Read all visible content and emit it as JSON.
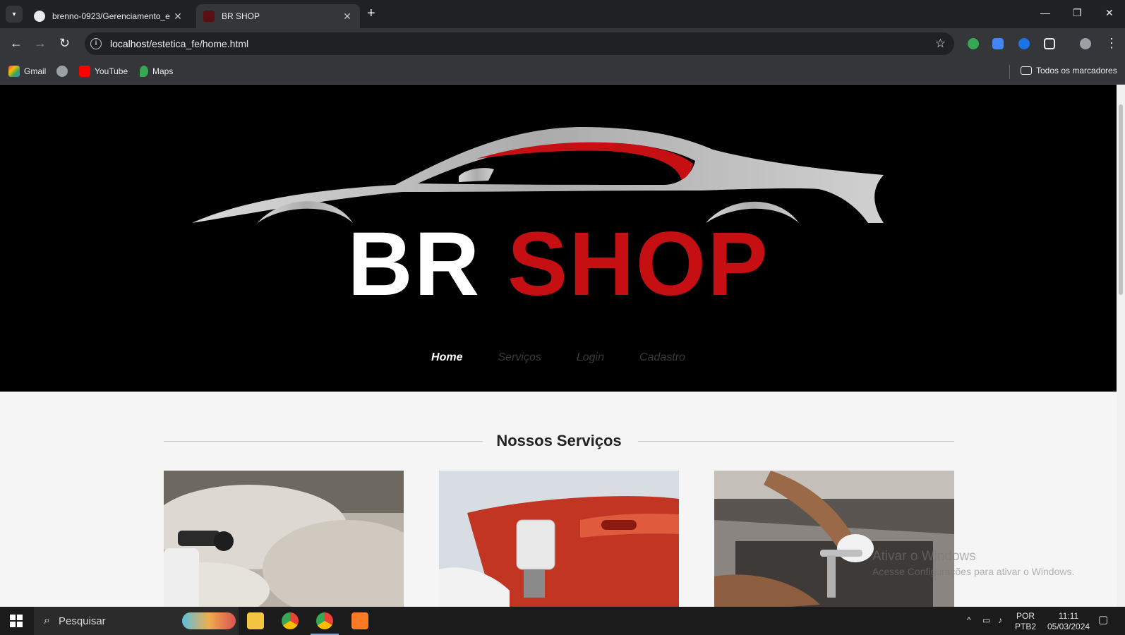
{
  "browser": {
    "tabs": [
      {
        "title": "brenno-0923/Gerenciamento_e",
        "active": false
      },
      {
        "title": "BR SHOP",
        "active": true
      }
    ],
    "url_host": "localhost",
    "url_path": "/estetica_fe/home.html",
    "bookmarks": [
      "Gmail",
      "YouTube",
      "Maps"
    ],
    "all_bookmarks": "Todos os marcadores"
  },
  "page": {
    "brand_white": "BR",
    "brand_red": "SHOP",
    "nav": [
      "Home",
      "Serviços",
      "Login",
      "Cadastro"
    ],
    "services_heading": "Nossos Serviços",
    "cards": [
      "car-foam-wash-photo",
      "car-paint-spray-photo",
      "engine-repair-photo"
    ]
  },
  "watermark": {
    "line1": "Ativar o Windows",
    "line2": "Acesse Configurações para ativar o Windows."
  },
  "taskbar": {
    "search_placeholder": "Pesquisar",
    "lang_top": "POR",
    "lang_bottom": "PTB2",
    "time": "11:11",
    "date": "05/03/2024"
  },
  "colors": {
    "brand_red": "#c50f13",
    "hero_bg": "#000000",
    "page_bg": "#f5f5f5"
  }
}
